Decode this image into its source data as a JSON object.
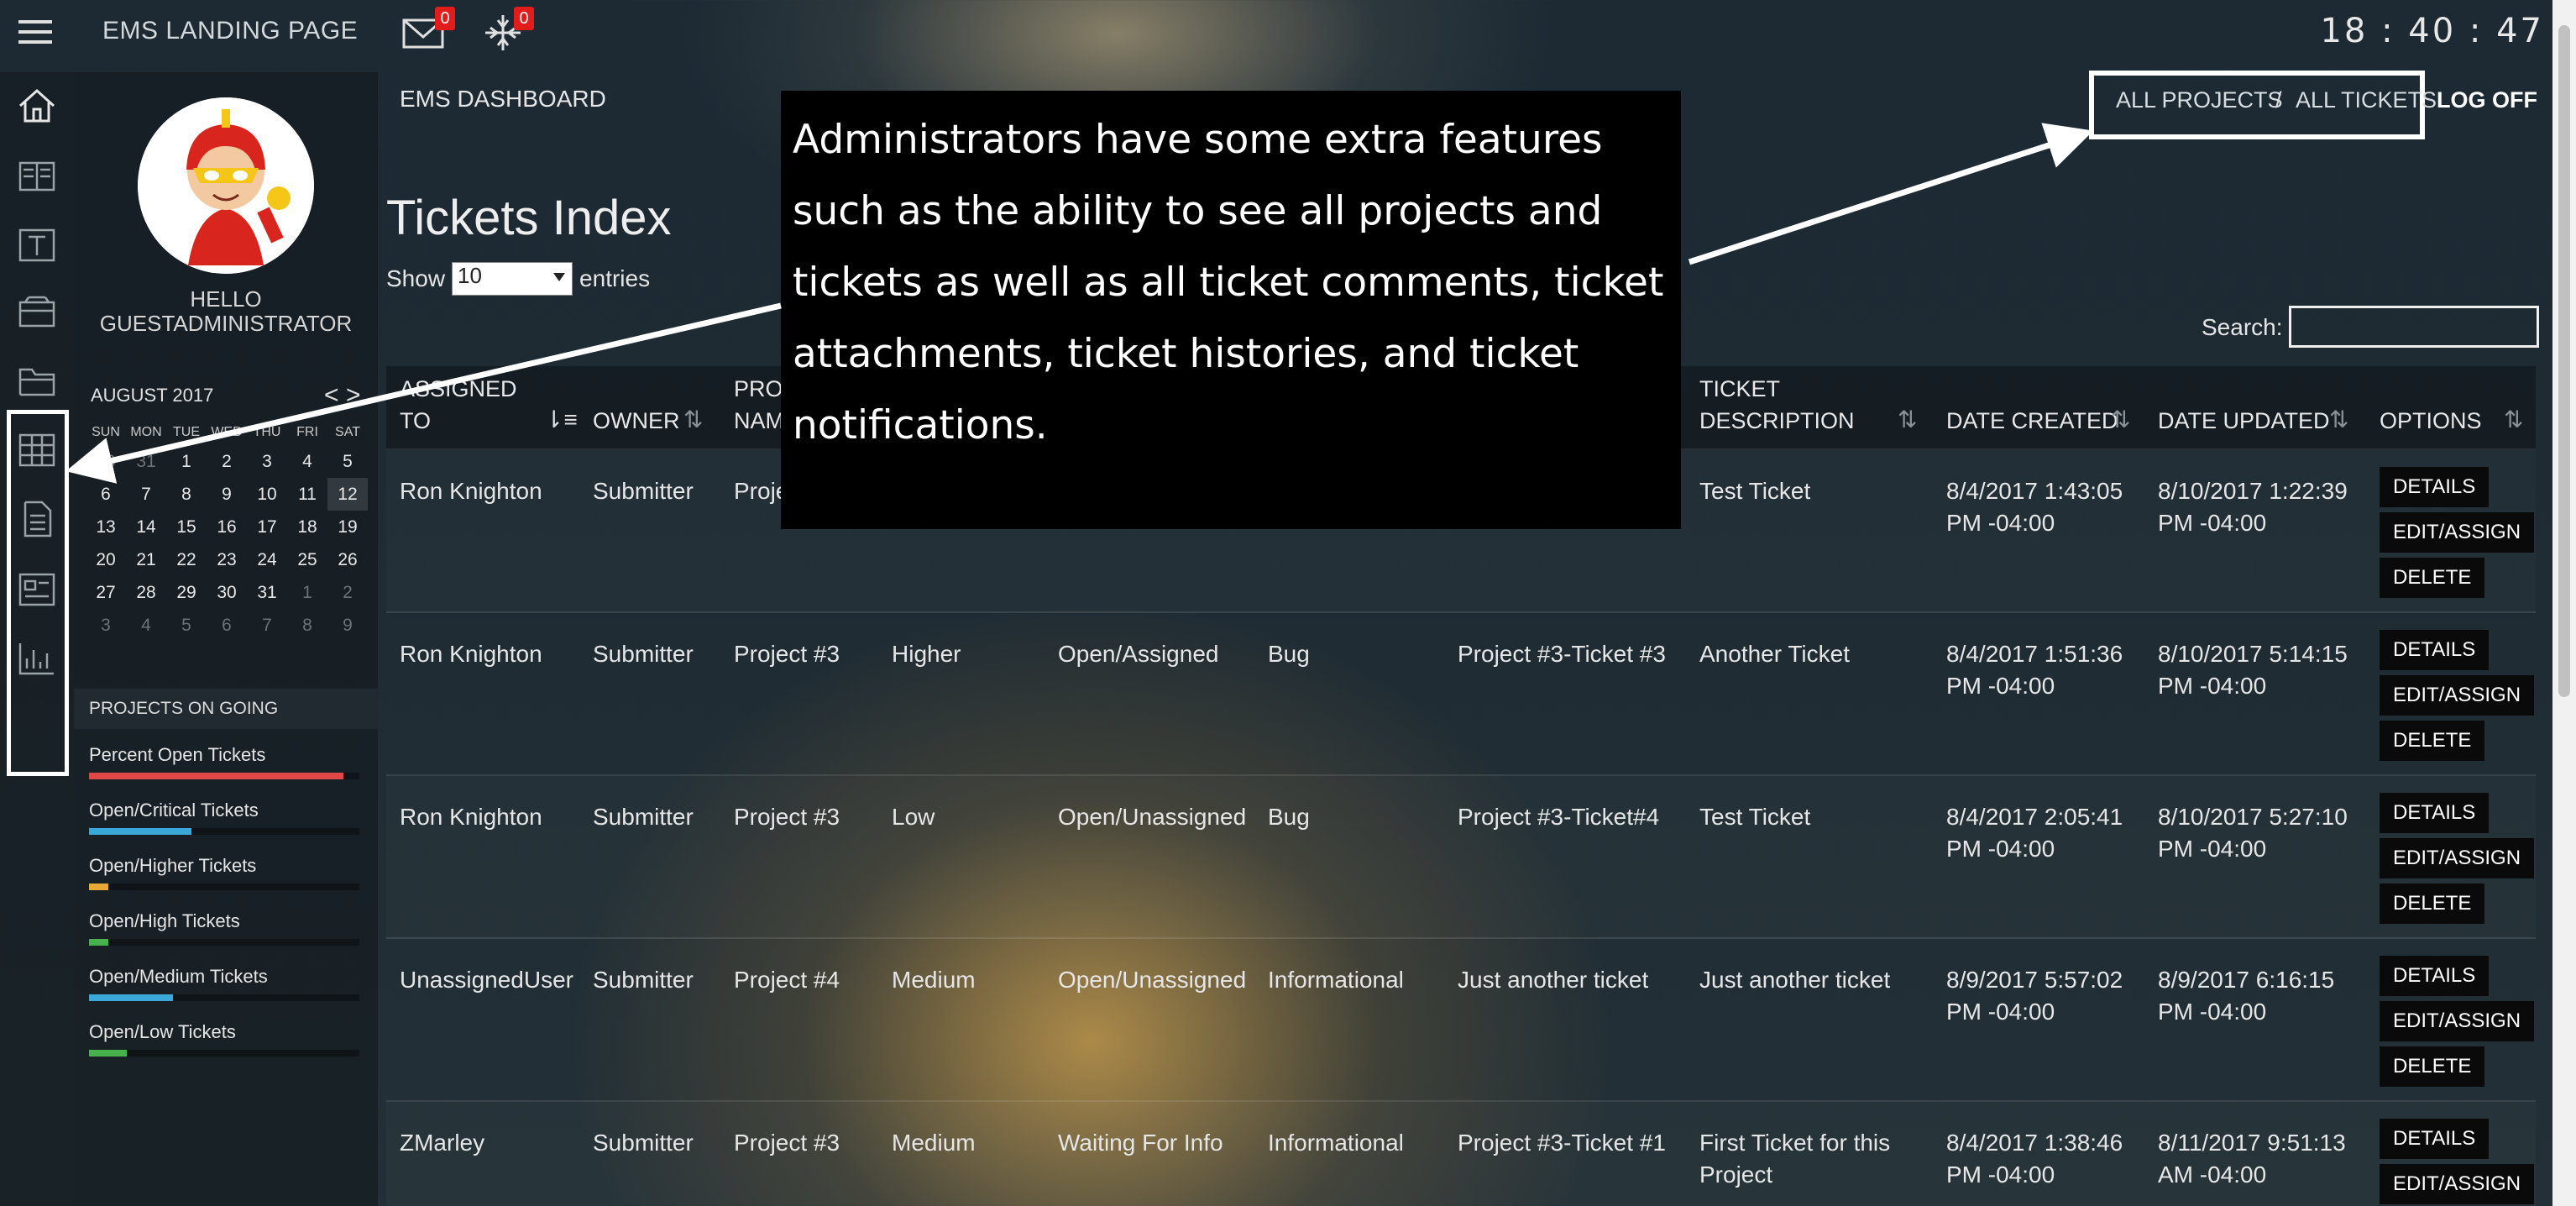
{
  "app": {
    "title": "EMS LANDING PAGE",
    "clock": "18 : 40 : 47"
  },
  "topbar": {
    "mail_count": "0",
    "notif_count": "0"
  },
  "sidebar_user": {
    "greeting": "HELLO",
    "username": "GUESTADMINISTRATOR"
  },
  "calendar": {
    "month": "AUGUST 2017",
    "prev": "<",
    "next": ">",
    "days_of_week": [
      "SUN",
      "MON",
      "TUE",
      "WED",
      "THU",
      "FRI",
      "SAT"
    ],
    "weeks": [
      [
        "30",
        "31",
        "1",
        "2",
        "3",
        "4",
        "5"
      ],
      [
        "6",
        "7",
        "8",
        "9",
        "10",
        "11",
        "12"
      ],
      [
        "13",
        "14",
        "15",
        "16",
        "17",
        "18",
        "19"
      ],
      [
        "20",
        "21",
        "22",
        "23",
        "24",
        "25",
        "26"
      ],
      [
        "27",
        "28",
        "29",
        "30",
        "31",
        "1",
        "2"
      ],
      [
        "3",
        "4",
        "5",
        "6",
        "7",
        "8",
        "9"
      ]
    ]
  },
  "projects": {
    "heading": "PROJECTS ON GOING",
    "items": [
      {
        "label": "Percent Open Tickets",
        "percent": 94,
        "color": "#e04848"
      },
      {
        "label": "Open/Critical Tickets",
        "percent": 38,
        "color": "#3aa8d8"
      },
      {
        "label": "Open/Higher Tickets",
        "percent": 7,
        "color": "#e8a636"
      },
      {
        "label": "Open/High Tickets",
        "percent": 7,
        "color": "#47b24c"
      },
      {
        "label": "Open/Medium Tickets",
        "percent": 31,
        "color": "#3aa8d8"
      },
      {
        "label": "Open/Low Tickets",
        "percent": 14,
        "color": "#47b24c"
      }
    ]
  },
  "header": {
    "dashboard": "EMS DASHBOARD",
    "all_projects": "ALL PROJECTS",
    "sep": "/",
    "all_tickets": "ALL TICKETS",
    "logoff": "LOG OFF"
  },
  "page": {
    "title": "Tickets Index",
    "show": "Show",
    "entries_value": "10",
    "entries": "entries",
    "search_label": "Search:"
  },
  "table": {
    "headers": {
      "assigned": "ASSIGNED\nTO",
      "owner": "OWNER",
      "project": "PROJECT\nNAME",
      "description": "TICKET\nDESCRIPTION",
      "created": "DATE CREATED",
      "updated": "DATE UPDATED",
      "options": "OPTIONS"
    },
    "buttons": {
      "details": "DETAILS",
      "edit": "EDIT/ASSIGN",
      "delete": "DELETE"
    },
    "rows": [
      {
        "assigned": "Ron Knighton",
        "owner": "Submitter",
        "project": "Project #3",
        "priority": "",
        "status": "",
        "type": "",
        "title": "",
        "description": "Test Ticket",
        "created": "8/4/2017 1:43:05\nPM -04:00",
        "updated": "8/10/2017 1:22:39\nPM -04:00"
      },
      {
        "assigned": "Ron Knighton",
        "owner": "Submitter",
        "project": "Project #3",
        "priority": "Higher",
        "status": "Open/Assigned",
        "type": "Bug",
        "title": "Project #3-Ticket #3",
        "description": "Another Ticket",
        "created": "8/4/2017 1:51:36\nPM -04:00",
        "updated": "8/10/2017 5:14:15\nPM -04:00"
      },
      {
        "assigned": "Ron Knighton",
        "owner": "Submitter",
        "project": "Project #3",
        "priority": "Low",
        "status": "Open/Unassigned",
        "type": "Bug",
        "title": "Project #3-Ticket#4",
        "description": "Test Ticket",
        "created": "8/4/2017 2:05:41\nPM -04:00",
        "updated": "8/10/2017 5:27:10\nPM -04:00"
      },
      {
        "assigned": "UnassignedUser",
        "owner": "Submitter",
        "project": "Project #4",
        "priority": "Medium",
        "status": "Open/Unassigned",
        "type": "Informational",
        "title": "Just another ticket",
        "description": "Just another ticket",
        "created": "8/9/2017 5:57:02\nPM -04:00",
        "updated": "8/9/2017 6:16:15\nPM -04:00"
      },
      {
        "assigned": "ZMarley",
        "owner": "Submitter",
        "project": "Project #3",
        "priority": "Medium",
        "status": "Waiting For Info",
        "type": "Informational",
        "title": "Project #3-Ticket #1",
        "description": "First Ticket for this\nProject",
        "created": "8/4/2017 1:38:46\nPM -04:00",
        "updated": "8/11/2017 9:51:13\nAM -04:00"
      }
    ]
  },
  "annotation": {
    "lines": [
      "Administrators have some extra features",
      "such as the ability to see all projects and",
      "tickets as well as all ticket comments, ticket",
      "attachments, ticket histories, and ticket",
      "notifications."
    ]
  }
}
